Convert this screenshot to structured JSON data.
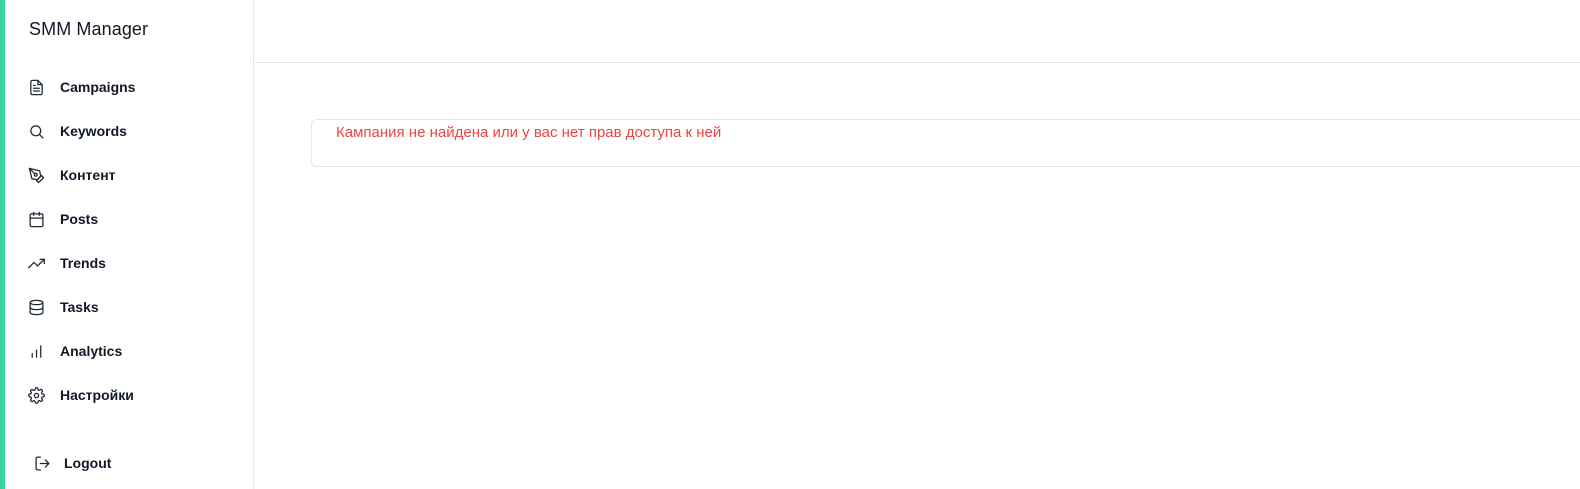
{
  "app": {
    "brand": "SMM Manager",
    "accent_color": "#34d8a6"
  },
  "sidebar": {
    "items": [
      {
        "label": "Campaigns",
        "icon": "file-text-icon"
      },
      {
        "label": "Keywords",
        "icon": "search-icon"
      },
      {
        "label": "Контент",
        "icon": "pen-tool-icon"
      },
      {
        "label": "Posts",
        "icon": "calendar-icon"
      },
      {
        "label": "Trends",
        "icon": "trending-up-icon"
      },
      {
        "label": "Tasks",
        "icon": "database-icon"
      },
      {
        "label": "Analytics",
        "icon": "bar-chart-icon"
      },
      {
        "label": "Настройки",
        "icon": "gear-icon"
      }
    ],
    "logout_label": "Logout"
  },
  "main": {
    "error_message": "Кампания не найдена или у вас нет прав доступа к ней",
    "error_color": "#ef4444"
  }
}
